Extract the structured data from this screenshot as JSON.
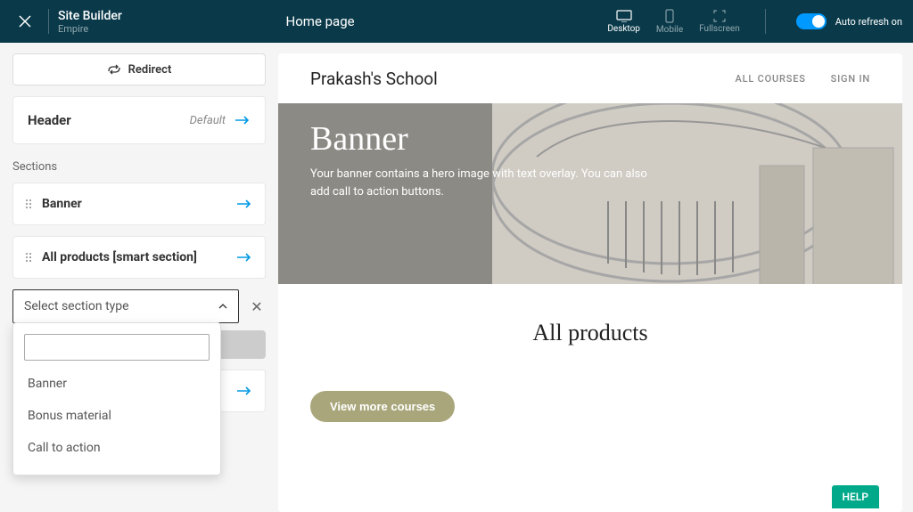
{
  "header": {
    "app_title": "Site Builder",
    "app_subtitle": "Empire",
    "page_name": "Home page",
    "views": {
      "desktop": "Desktop",
      "mobile": "Mobile",
      "fullscreen": "Fullscreen"
    },
    "auto_refresh": "Auto refresh on"
  },
  "sidebar": {
    "redirect": "Redirect",
    "header_label": "Header",
    "header_default": "Default",
    "sections_title": "Sections",
    "sections": [
      {
        "label": "Banner"
      },
      {
        "label": "All products [smart section]"
      }
    ],
    "select_placeholder": "Select section type",
    "dropdown_options": [
      "Banner",
      "Bonus material",
      "Call to action"
    ]
  },
  "preview": {
    "school_name": "Prakash's School",
    "nav": {
      "all_courses": "ALL COURSES",
      "sign_in": "SIGN IN"
    },
    "banner": {
      "title": "Banner",
      "desc": "Your banner contains a hero image with text overlay. You can also add call to action buttons."
    },
    "products": {
      "title": "All products",
      "view_more": "View more courses"
    }
  },
  "help": "HELP"
}
